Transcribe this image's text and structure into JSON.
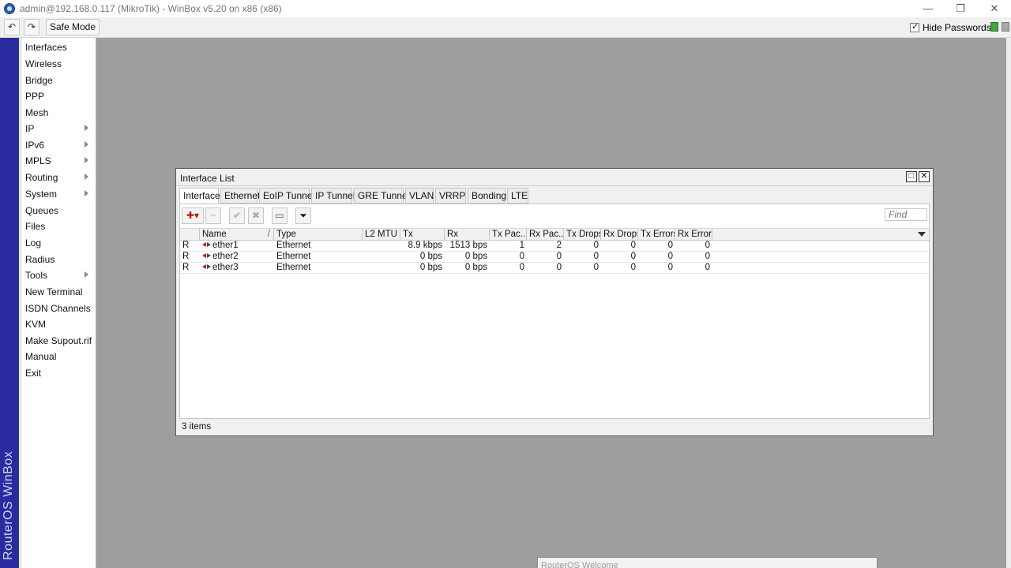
{
  "window": {
    "title": "admin@192.168.0.117 (MikroTik) - WinBox v5.20 on x86 (x86)",
    "minimize": "—",
    "restore": "❐",
    "close": "✕"
  },
  "toolbar": {
    "undo_icon": "↶",
    "redo_icon": "↷",
    "safe_mode_label": "Safe Mode",
    "hide_passwords_label": "Hide Passwords"
  },
  "brand": {
    "vertical_text": "RouterOS WinBox",
    "band_color": "#2b2ba0"
  },
  "sidebar": {
    "items": [
      {
        "label": "Interfaces",
        "submenu": false
      },
      {
        "label": "Wireless",
        "submenu": false
      },
      {
        "label": "Bridge",
        "submenu": false
      },
      {
        "label": "PPP",
        "submenu": false
      },
      {
        "label": "Mesh",
        "submenu": false
      },
      {
        "label": "IP",
        "submenu": true
      },
      {
        "label": "IPv6",
        "submenu": true
      },
      {
        "label": "MPLS",
        "submenu": true
      },
      {
        "label": "Routing",
        "submenu": true
      },
      {
        "label": "System",
        "submenu": true
      },
      {
        "label": "Queues",
        "submenu": false
      },
      {
        "label": "Files",
        "submenu": false
      },
      {
        "label": "Log",
        "submenu": false
      },
      {
        "label": "Radius",
        "submenu": false
      },
      {
        "label": "Tools",
        "submenu": true
      },
      {
        "label": "New Terminal",
        "submenu": false
      },
      {
        "label": "ISDN Channels",
        "submenu": false
      },
      {
        "label": "KVM",
        "submenu": false
      },
      {
        "label": "Make Supout.rif",
        "submenu": false
      },
      {
        "label": "Manual",
        "submenu": false
      },
      {
        "label": "Exit",
        "submenu": false
      }
    ]
  },
  "interface_list": {
    "title": "Interface List",
    "maximize_icon": "□",
    "close_icon": "✕",
    "tabs": [
      "Interface",
      "Ethernet",
      "EoIP Tunnel",
      "IP Tunnel",
      "GRE Tunnel",
      "VLAN",
      "VRRP",
      "Bonding",
      "LTE"
    ],
    "active_tab": "Interface",
    "toolbar": {
      "add_icon": "✚▾",
      "remove_icon": "−",
      "enable_icon": "✔",
      "disable_icon": "✖",
      "comment_icon": "▭",
      "filter_icon": "⏷",
      "find_placeholder": "Find"
    },
    "columns": [
      "Name",
      "Type",
      "L2 MTU",
      "Tx",
      "Rx",
      "Tx Pac...",
      "Rx Pac...",
      "Tx Drops",
      "Rx Drops",
      "Tx Errors",
      "Rx Errors"
    ],
    "sort_indicator": "/",
    "rows": [
      {
        "flag": "R",
        "name": "ether1",
        "type": "Ethernet",
        "l2mtu": "",
        "tx": "8.9 kbps",
        "rx": "1513 bps",
        "tx_pac": "1",
        "rx_pac": "2",
        "tx_drops": "0",
        "rx_drops": "0",
        "tx_errors": "0",
        "rx_errors": "0"
      },
      {
        "flag": "R",
        "name": "ether2",
        "type": "Ethernet",
        "l2mtu": "",
        "tx": "0 bps",
        "rx": "0 bps",
        "tx_pac": "0",
        "rx_pac": "0",
        "tx_drops": "0",
        "rx_drops": "0",
        "tx_errors": "0",
        "rx_errors": "0"
      },
      {
        "flag": "R",
        "name": "ether3",
        "type": "Ethernet",
        "l2mtu": "",
        "tx": "0 bps",
        "rx": "0 bps",
        "tx_pac": "0",
        "rx_pac": "0",
        "tx_drops": "0",
        "rx_drops": "0",
        "tx_errors": "0",
        "rx_errors": "0"
      }
    ],
    "status": "3 items"
  },
  "welcome_window": {
    "title": "RouterOS Welcome"
  }
}
